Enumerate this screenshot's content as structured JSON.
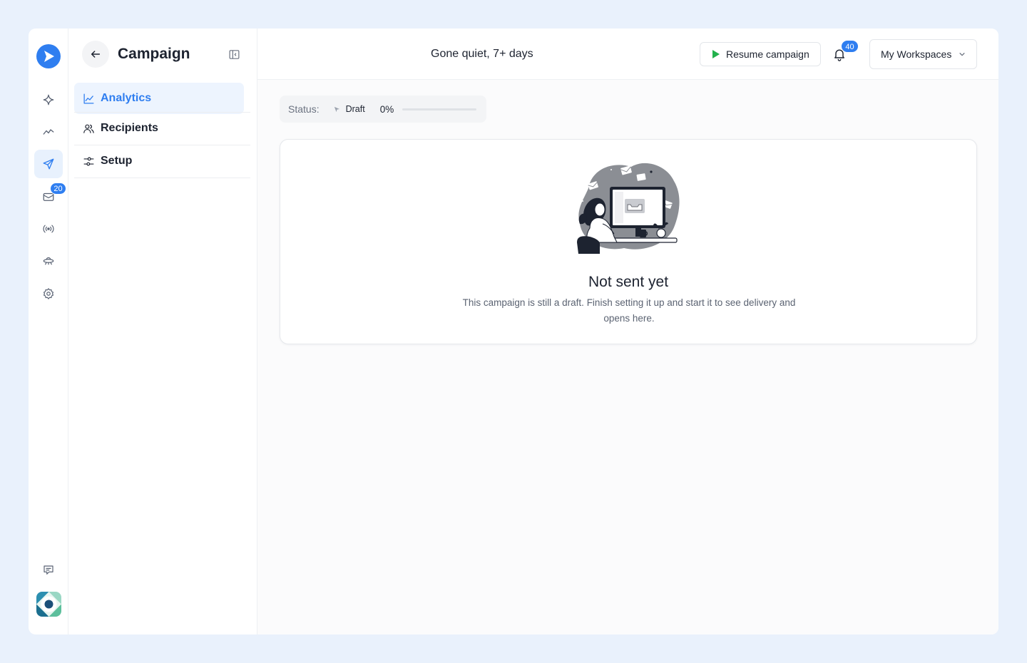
{
  "app": {
    "brand_color": "#2f7ef0"
  },
  "rail": {
    "items": [
      {
        "name": "sparkle-icon"
      },
      {
        "name": "trend-icon"
      },
      {
        "name": "send-icon",
        "active": true
      },
      {
        "name": "inbox-icon",
        "badge": "20"
      },
      {
        "name": "broadcast-icon"
      },
      {
        "name": "ufo-icon"
      },
      {
        "name": "gear-icon"
      },
      {
        "name": "feedback-icon"
      }
    ],
    "inbox_badge": "20"
  },
  "panel": {
    "title": "Campaign",
    "nav": [
      {
        "label": "Analytics",
        "icon": "chart-line-icon",
        "active": true
      },
      {
        "label": "Recipients",
        "icon": "users-icon"
      },
      {
        "label": "Setup",
        "icon": "sliders-icon"
      }
    ]
  },
  "topbar": {
    "campaign_name": "Gone quiet, 7+ days",
    "resume_label": "Resume campaign",
    "notification_count": "40",
    "workspace_label": "My Workspaces"
  },
  "status": {
    "label": "Status:",
    "state": "Draft",
    "percent_text": "0%",
    "progress": 0
  },
  "empty_state": {
    "title": "Not sent yet",
    "description": "This campaign is still a draft. Finish setting it up and start it to see delivery and opens here."
  },
  "colors": {
    "accent": "#2f7ef0",
    "play_green": "#22b14c",
    "active_bg": "#edf4fe"
  }
}
